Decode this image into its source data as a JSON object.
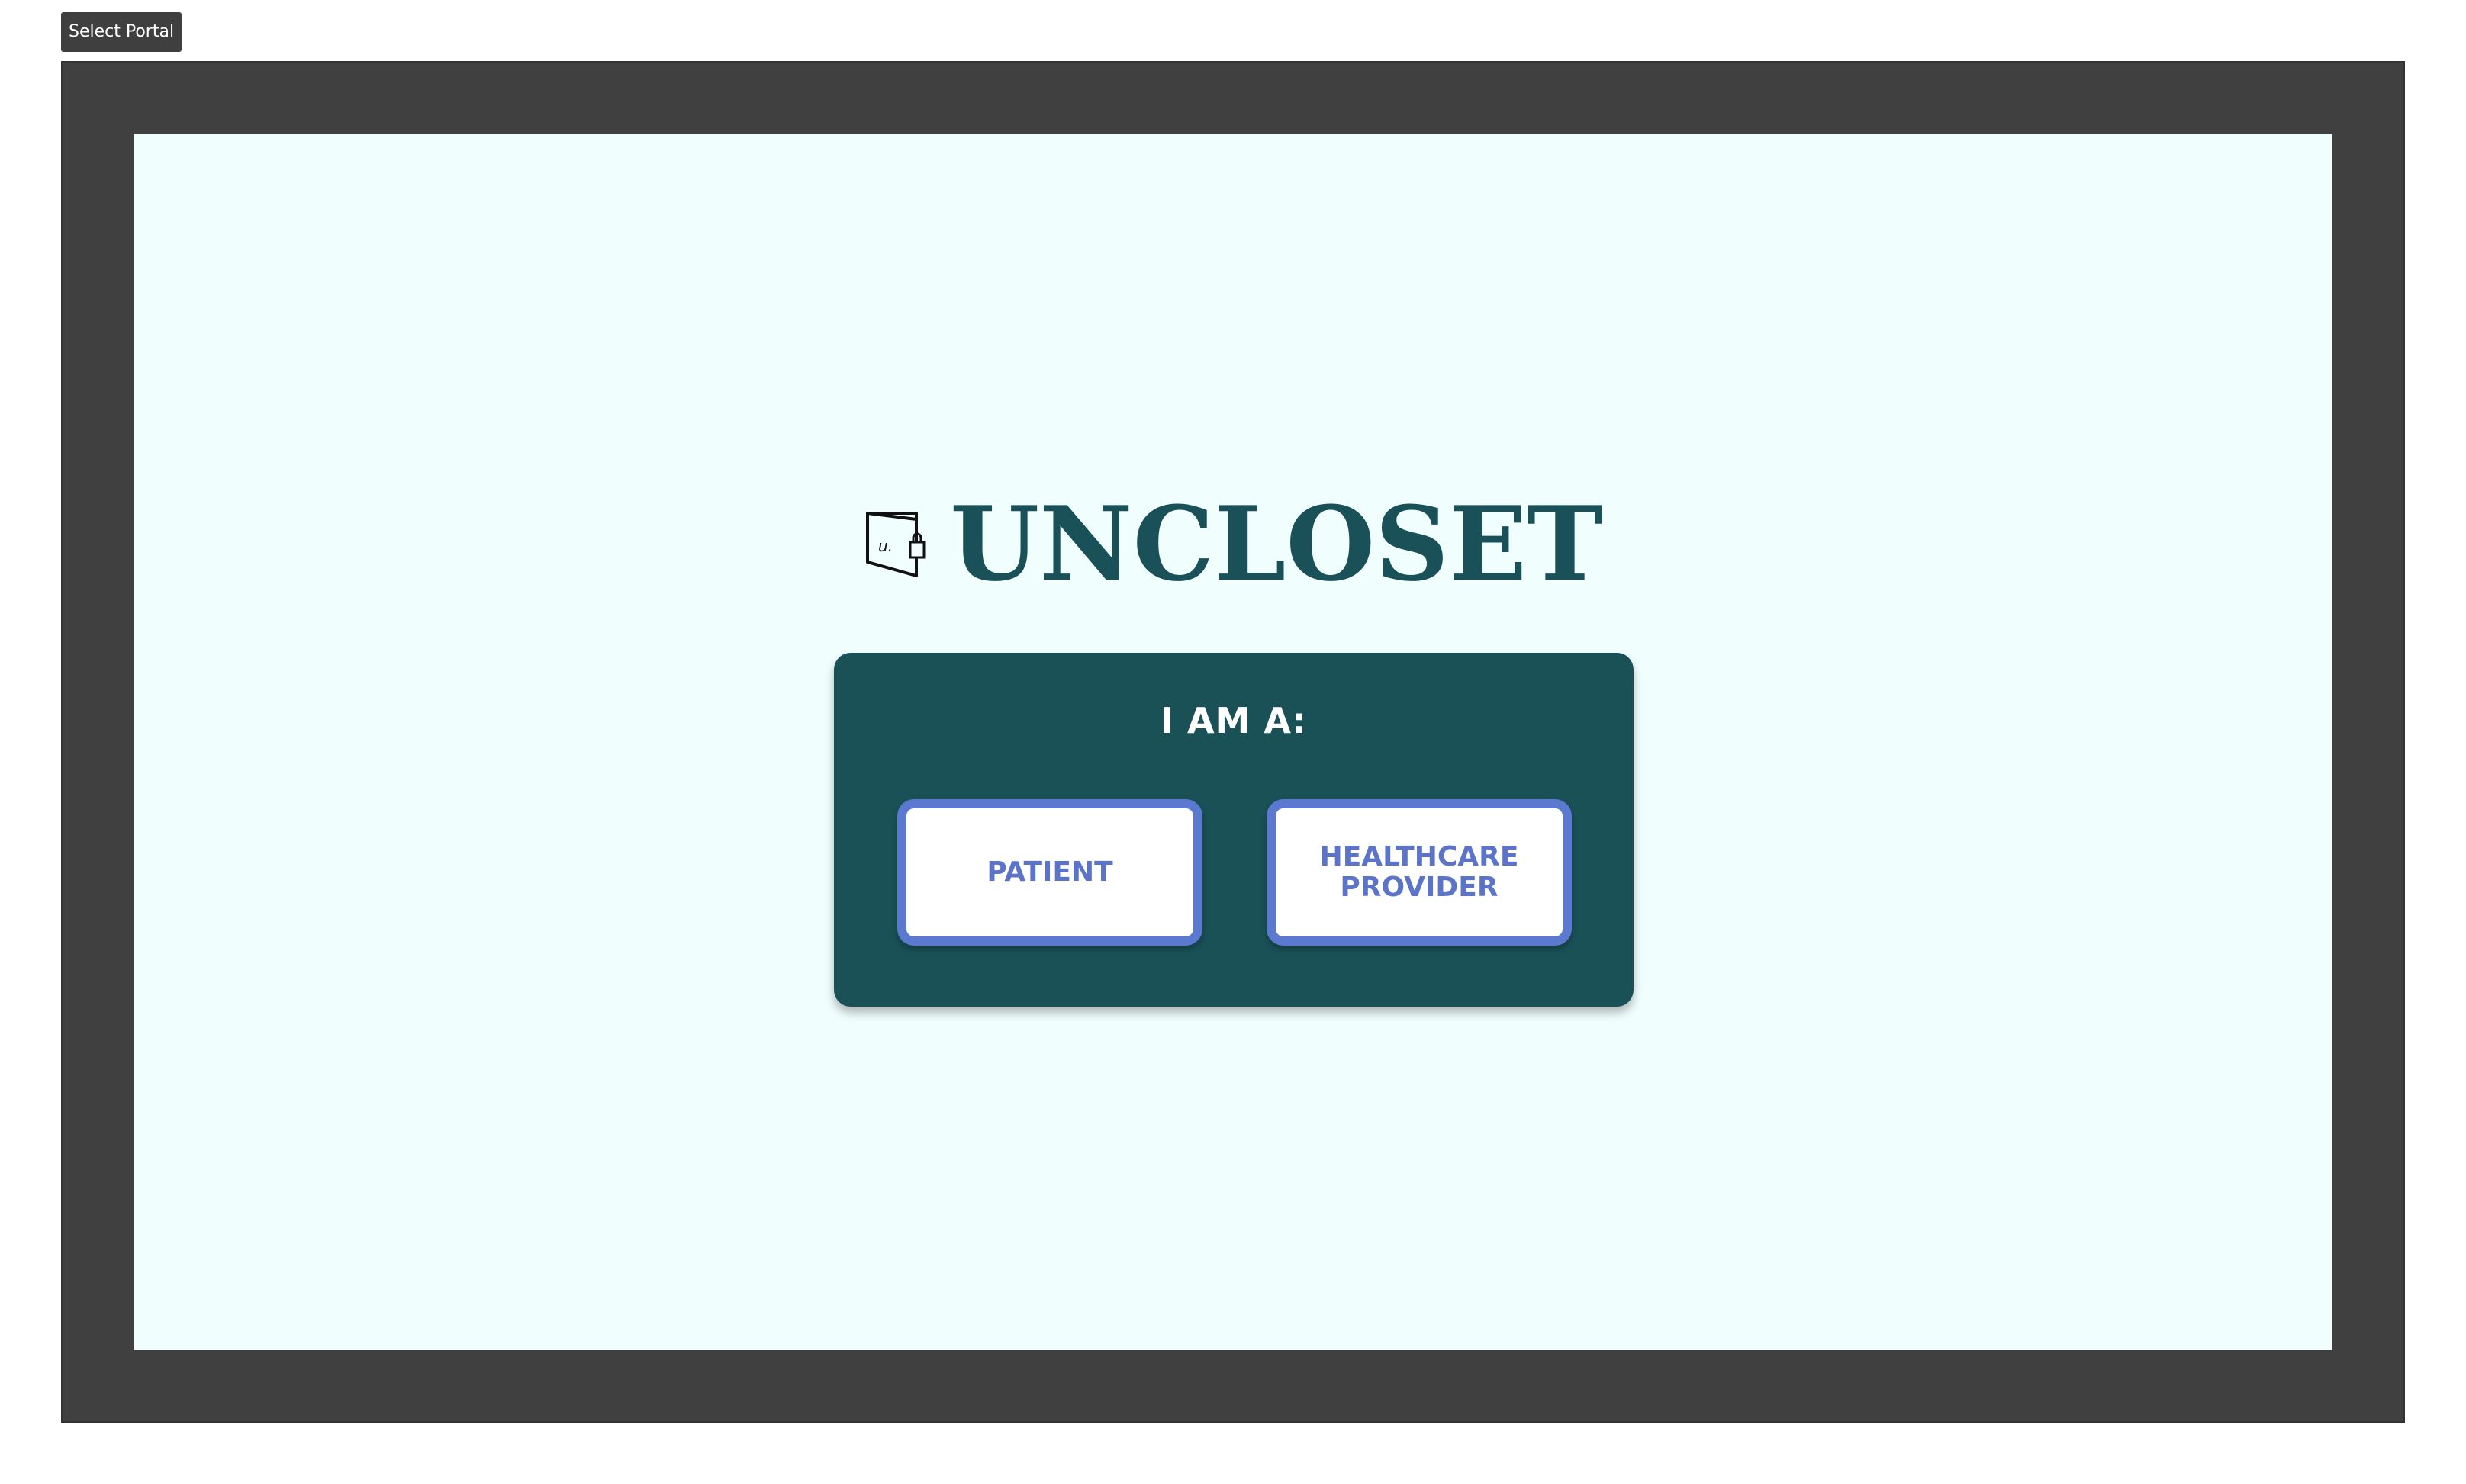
{
  "frame": {
    "label": "Select Portal"
  },
  "brand": {
    "name": "UNCLOSET",
    "logo_icon": "closet-door-logo-icon",
    "logo_text": "u."
  },
  "role_card": {
    "title": "I AM A:",
    "patient_label": "PATIENT",
    "provider_label": "HEALTHCARE\nPROVIDER"
  },
  "colors": {
    "frame": "#404040",
    "screen_background": "#f0fefe",
    "brand_teal": "#1a5159",
    "card_background": "#195157",
    "button_border": "#5a79cf",
    "button_text": "#5b74c9"
  }
}
